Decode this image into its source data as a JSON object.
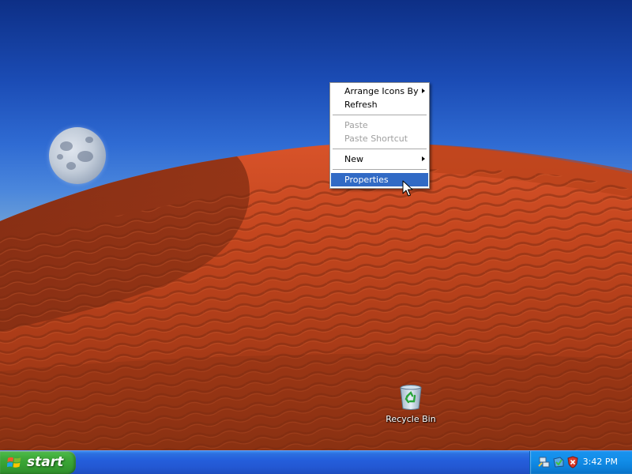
{
  "desktop": {
    "wallpaper": "red-dune-with-moon",
    "icons": [
      {
        "label": "Recycle Bin",
        "icon": "recycle-bin-icon"
      }
    ]
  },
  "context_menu": {
    "items": [
      {
        "label": "Arrange Icons By",
        "enabled": true,
        "submenu": true
      },
      {
        "label": "Refresh",
        "enabled": true,
        "submenu": false
      },
      {
        "label": "Paste",
        "enabled": false,
        "submenu": false
      },
      {
        "label": "Paste Shortcut",
        "enabled": false,
        "submenu": false
      },
      {
        "label": "New",
        "enabled": true,
        "submenu": true
      },
      {
        "label": "Properties",
        "enabled": true,
        "submenu": false,
        "highlighted": true
      }
    ]
  },
  "taskbar": {
    "start_label": "start",
    "tray_icons": [
      "network-icon",
      "update-icon",
      "security-shield-icon"
    ],
    "clock": "3:42 PM"
  },
  "colors": {
    "taskbar": "#245edb",
    "start_button": "#3fa93a",
    "tray": "#0f8ce6",
    "menu_highlight": "#316ac5",
    "menu_disabled_text": "#a0a0a0",
    "sky_top": "#0d2f86",
    "dune": "#c4461e"
  }
}
